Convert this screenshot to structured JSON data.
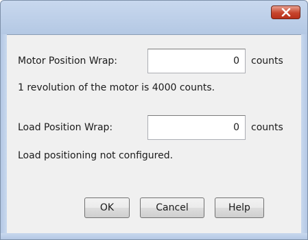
{
  "titlebar": {
    "close_icon": "close-icon"
  },
  "motor": {
    "label": "Motor Position Wrap:",
    "value": "0",
    "unit": "counts",
    "info": "1 revolution of the motor is 4000 counts."
  },
  "load": {
    "label": "Load Position Wrap:",
    "value": "0",
    "unit": "counts",
    "info": "Load positioning not configured."
  },
  "buttons": {
    "ok": "OK",
    "cancel": "Cancel",
    "help": "Help"
  },
  "colors": {
    "titlebar": "#b4c8e4",
    "client": "#f0f0f0",
    "close_button": "#c7442c"
  }
}
